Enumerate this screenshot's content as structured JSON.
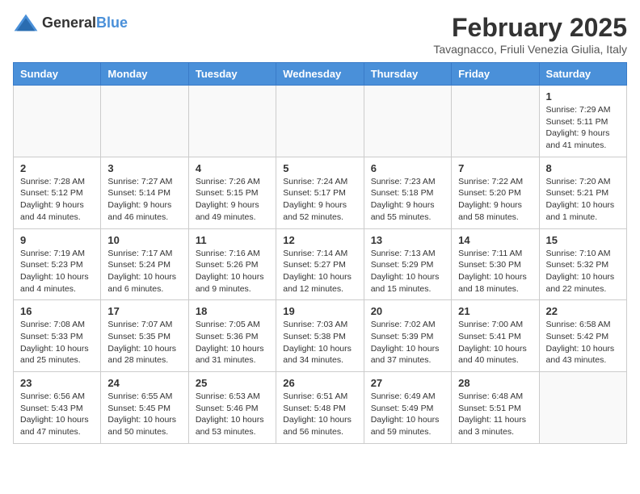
{
  "header": {
    "logo_general": "General",
    "logo_blue": "Blue",
    "month_title": "February 2025",
    "subtitle": "Tavagnacco, Friuli Venezia Giulia, Italy"
  },
  "weekdays": [
    "Sunday",
    "Monday",
    "Tuesday",
    "Wednesday",
    "Thursday",
    "Friday",
    "Saturday"
  ],
  "weeks": [
    [
      {
        "day": "",
        "info": ""
      },
      {
        "day": "",
        "info": ""
      },
      {
        "day": "",
        "info": ""
      },
      {
        "day": "",
        "info": ""
      },
      {
        "day": "",
        "info": ""
      },
      {
        "day": "",
        "info": ""
      },
      {
        "day": "1",
        "info": "Sunrise: 7:29 AM\nSunset: 5:11 PM\nDaylight: 9 hours and 41 minutes."
      }
    ],
    [
      {
        "day": "2",
        "info": "Sunrise: 7:28 AM\nSunset: 5:12 PM\nDaylight: 9 hours and 44 minutes."
      },
      {
        "day": "3",
        "info": "Sunrise: 7:27 AM\nSunset: 5:14 PM\nDaylight: 9 hours and 46 minutes."
      },
      {
        "day": "4",
        "info": "Sunrise: 7:26 AM\nSunset: 5:15 PM\nDaylight: 9 hours and 49 minutes."
      },
      {
        "day": "5",
        "info": "Sunrise: 7:24 AM\nSunset: 5:17 PM\nDaylight: 9 hours and 52 minutes."
      },
      {
        "day": "6",
        "info": "Sunrise: 7:23 AM\nSunset: 5:18 PM\nDaylight: 9 hours and 55 minutes."
      },
      {
        "day": "7",
        "info": "Sunrise: 7:22 AM\nSunset: 5:20 PM\nDaylight: 9 hours and 58 minutes."
      },
      {
        "day": "8",
        "info": "Sunrise: 7:20 AM\nSunset: 5:21 PM\nDaylight: 10 hours and 1 minute."
      }
    ],
    [
      {
        "day": "9",
        "info": "Sunrise: 7:19 AM\nSunset: 5:23 PM\nDaylight: 10 hours and 4 minutes."
      },
      {
        "day": "10",
        "info": "Sunrise: 7:17 AM\nSunset: 5:24 PM\nDaylight: 10 hours and 6 minutes."
      },
      {
        "day": "11",
        "info": "Sunrise: 7:16 AM\nSunset: 5:26 PM\nDaylight: 10 hours and 9 minutes."
      },
      {
        "day": "12",
        "info": "Sunrise: 7:14 AM\nSunset: 5:27 PM\nDaylight: 10 hours and 12 minutes."
      },
      {
        "day": "13",
        "info": "Sunrise: 7:13 AM\nSunset: 5:29 PM\nDaylight: 10 hours and 15 minutes."
      },
      {
        "day": "14",
        "info": "Sunrise: 7:11 AM\nSunset: 5:30 PM\nDaylight: 10 hours and 18 minutes."
      },
      {
        "day": "15",
        "info": "Sunrise: 7:10 AM\nSunset: 5:32 PM\nDaylight: 10 hours and 22 minutes."
      }
    ],
    [
      {
        "day": "16",
        "info": "Sunrise: 7:08 AM\nSunset: 5:33 PM\nDaylight: 10 hours and 25 minutes."
      },
      {
        "day": "17",
        "info": "Sunrise: 7:07 AM\nSunset: 5:35 PM\nDaylight: 10 hours and 28 minutes."
      },
      {
        "day": "18",
        "info": "Sunrise: 7:05 AM\nSunset: 5:36 PM\nDaylight: 10 hours and 31 minutes."
      },
      {
        "day": "19",
        "info": "Sunrise: 7:03 AM\nSunset: 5:38 PM\nDaylight: 10 hours and 34 minutes."
      },
      {
        "day": "20",
        "info": "Sunrise: 7:02 AM\nSunset: 5:39 PM\nDaylight: 10 hours and 37 minutes."
      },
      {
        "day": "21",
        "info": "Sunrise: 7:00 AM\nSunset: 5:41 PM\nDaylight: 10 hours and 40 minutes."
      },
      {
        "day": "22",
        "info": "Sunrise: 6:58 AM\nSunset: 5:42 PM\nDaylight: 10 hours and 43 minutes."
      }
    ],
    [
      {
        "day": "23",
        "info": "Sunrise: 6:56 AM\nSunset: 5:43 PM\nDaylight: 10 hours and 47 minutes."
      },
      {
        "day": "24",
        "info": "Sunrise: 6:55 AM\nSunset: 5:45 PM\nDaylight: 10 hours and 50 minutes."
      },
      {
        "day": "25",
        "info": "Sunrise: 6:53 AM\nSunset: 5:46 PM\nDaylight: 10 hours and 53 minutes."
      },
      {
        "day": "26",
        "info": "Sunrise: 6:51 AM\nSunset: 5:48 PM\nDaylight: 10 hours and 56 minutes."
      },
      {
        "day": "27",
        "info": "Sunrise: 6:49 AM\nSunset: 5:49 PM\nDaylight: 10 hours and 59 minutes."
      },
      {
        "day": "28",
        "info": "Sunrise: 6:48 AM\nSunset: 5:51 PM\nDaylight: 11 hours and 3 minutes."
      },
      {
        "day": "",
        "info": ""
      }
    ]
  ]
}
